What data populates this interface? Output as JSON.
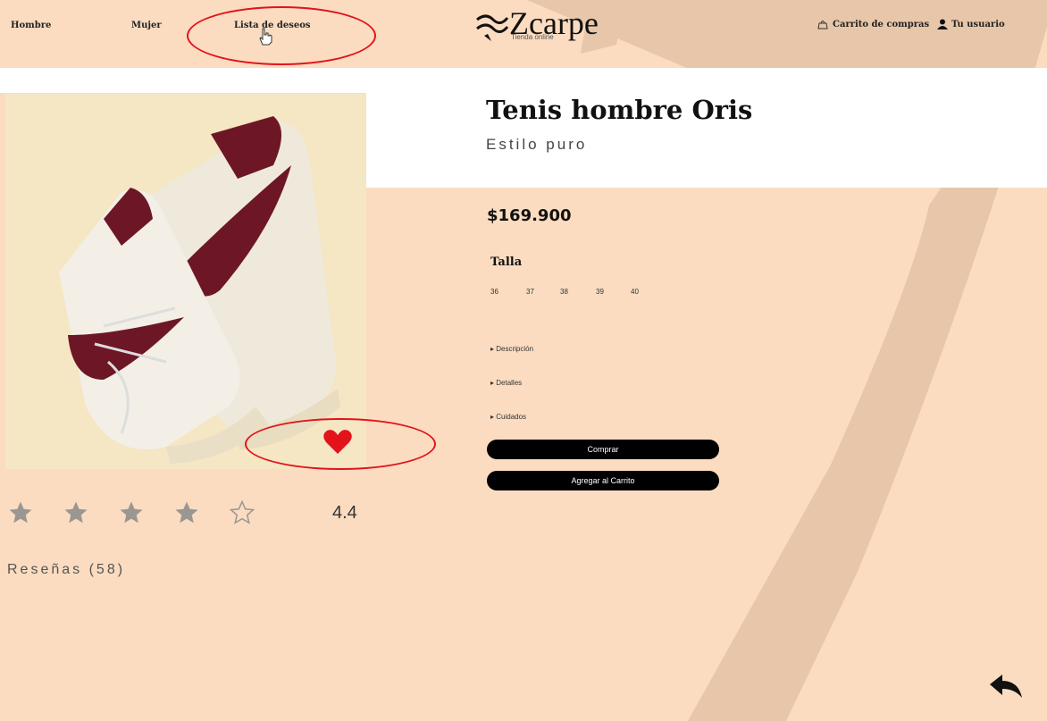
{
  "nav": {
    "men": "Hombre",
    "women": "Mujer",
    "wishlist": "Lista de deseos",
    "cart": "Carrito de compras",
    "user": "Tu usuario"
  },
  "logo": {
    "brand": "Zcarpe",
    "tagline": "Tienda online"
  },
  "product": {
    "title": "Tenis hombre Oris",
    "subtitle": "Estilo puro",
    "price": "$169.900",
    "size_label": "Talla",
    "sizes": [
      "36",
      "37",
      "38",
      "39",
      "40"
    ],
    "accordions": [
      "Descripción",
      "Detalles",
      "Cuidados"
    ],
    "buy_button": "Comprar",
    "add_to_cart_button": "Agregar al Carrito"
  },
  "rating": {
    "value": "4.4",
    "filled_stars": 4,
    "total_stars": 5
  },
  "reviews": {
    "label": "Reseñas (58)"
  },
  "colors": {
    "background": "#fbdcc0",
    "accent_shape": "#e6c3a6",
    "heart": "#e3131b",
    "button": "#000000",
    "annotation_ring": "#e3131b"
  },
  "icons": [
    "cart-icon",
    "user-icon",
    "heart-icon",
    "star-icon",
    "back-arrow-icon",
    "hand-cursor-icon"
  ]
}
